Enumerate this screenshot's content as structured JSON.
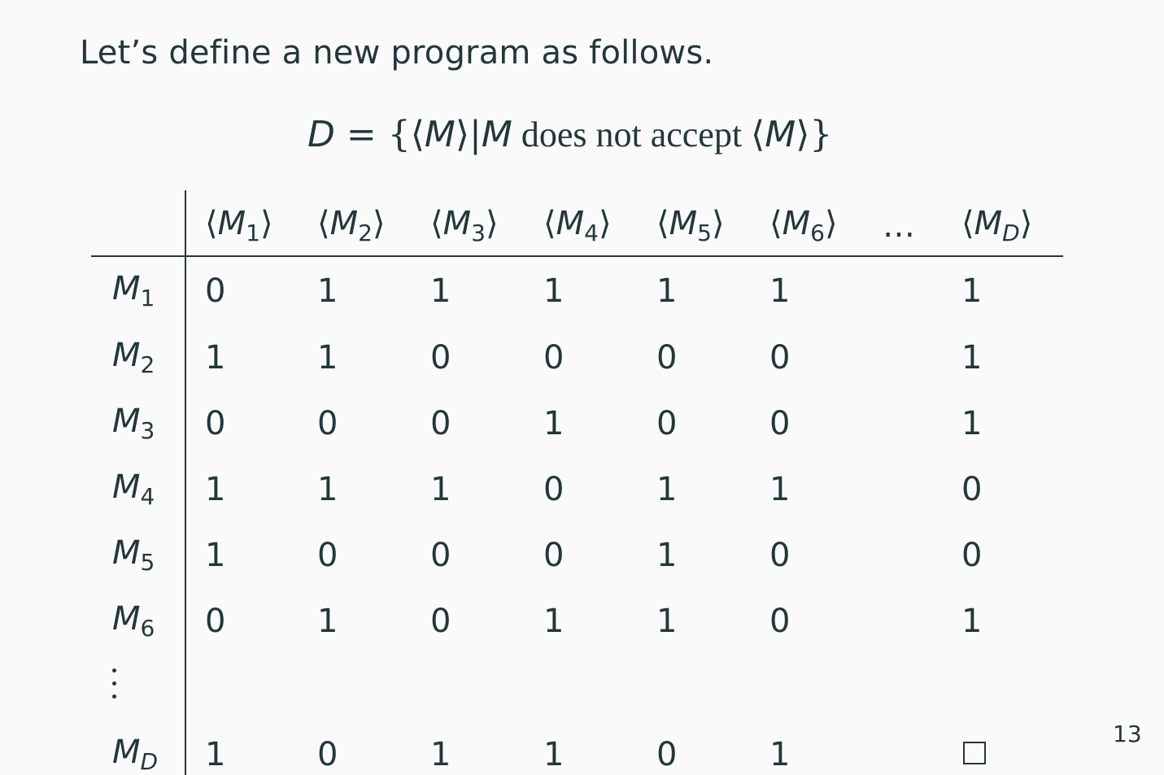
{
  "intro_text": "Let’s define a new program as follows.",
  "formula": {
    "lhs": "D",
    "eq": " = {⟨",
    "m1": "M",
    "mid1": "⟩|",
    "m2": "M",
    "text": " does not accept ",
    "open": "⟨",
    "m3": "M",
    "close": "⟩}"
  },
  "table": {
    "column_headers": [
      {
        "base": "M",
        "sub": "1"
      },
      {
        "base": "M",
        "sub": "2"
      },
      {
        "base": "M",
        "sub": "3"
      },
      {
        "base": "M",
        "sub": "4"
      },
      {
        "base": "M",
        "sub": "5"
      },
      {
        "base": "M",
        "sub": "6"
      },
      {
        "ellipsis": "…"
      },
      {
        "base": "M",
        "sub": "D"
      }
    ],
    "rows": [
      {
        "label": {
          "base": "M",
          "sub": "1"
        },
        "cells": [
          "0",
          "1",
          "1",
          "1",
          "1",
          "1",
          "",
          "1"
        ]
      },
      {
        "label": {
          "base": "M",
          "sub": "2"
        },
        "cells": [
          "1",
          "1",
          "0",
          "0",
          "0",
          "0",
          "",
          "1"
        ]
      },
      {
        "label": {
          "base": "M",
          "sub": "3"
        },
        "cells": [
          "0",
          "0",
          "0",
          "1",
          "0",
          "0",
          "",
          "1"
        ]
      },
      {
        "label": {
          "base": "M",
          "sub": "4"
        },
        "cells": [
          "1",
          "1",
          "1",
          "0",
          "1",
          "1",
          "",
          "0"
        ]
      },
      {
        "label": {
          "base": "M",
          "sub": "5"
        },
        "cells": [
          "1",
          "0",
          "0",
          "0",
          "1",
          "0",
          "",
          "0"
        ]
      },
      {
        "label": {
          "base": "M",
          "sub": "6"
        },
        "cells": [
          "0",
          "1",
          "0",
          "1",
          "1",
          "0",
          "",
          "1"
        ]
      },
      {
        "label": {
          "base": "M",
          "sub": "D"
        },
        "cells": [
          "1",
          "0",
          "1",
          "1",
          "0",
          "1",
          "",
          "□"
        ]
      }
    ]
  },
  "page_number": "13"
}
